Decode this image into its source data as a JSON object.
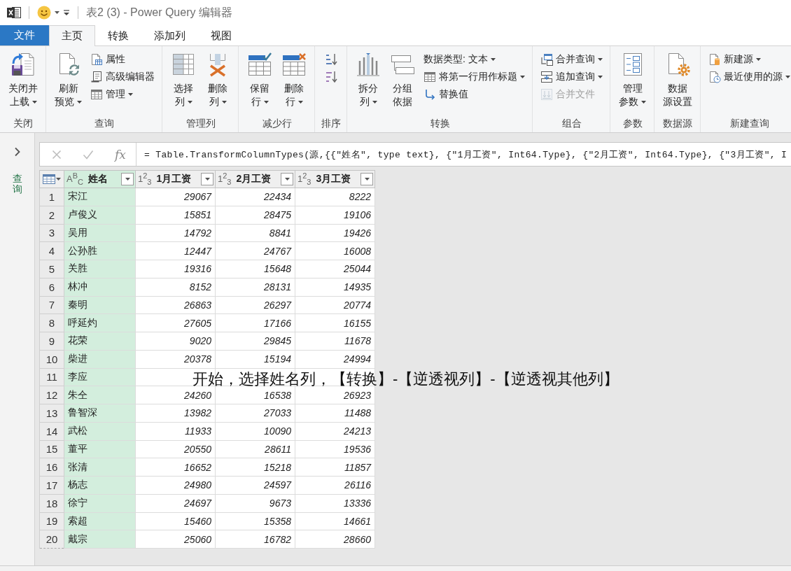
{
  "title_bar": {
    "title": "表2 (3) - Power Query 编辑器"
  },
  "tabs": [
    {
      "label": "文件",
      "kind": "file",
      "selected": false
    },
    {
      "label": "主页",
      "kind": "tab",
      "selected": true
    },
    {
      "label": "转换",
      "kind": "tab",
      "selected": false
    },
    {
      "label": "添加列",
      "kind": "tab",
      "selected": false
    },
    {
      "label": "视图",
      "kind": "tab",
      "selected": false
    }
  ],
  "ribbon": {
    "groups": [
      {
        "label": "关闭",
        "items": [
          {
            "kind": "large",
            "lines": [
              "关闭并",
              "上载"
            ],
            "dropdown": true,
            "disabled": false
          }
        ]
      },
      {
        "label": "查询",
        "items": [
          {
            "kind": "large",
            "lines": [
              "刷新",
              "预览"
            ],
            "dropdown": true,
            "disabled": false
          },
          {
            "kind": "small",
            "label": "属性",
            "dropdown": false,
            "disabled": false
          },
          {
            "kind": "small",
            "label": "高级编辑器",
            "dropdown": false,
            "disabled": false
          },
          {
            "kind": "small",
            "label": "管理",
            "dropdown": true,
            "disabled": false
          }
        ]
      },
      {
        "label": "管理列",
        "items": [
          {
            "kind": "large",
            "lines": [
              "选择",
              "列"
            ],
            "dropdown": true,
            "disabled": false
          },
          {
            "kind": "large",
            "lines": [
              "删除",
              "列"
            ],
            "dropdown": true,
            "disabled": false
          }
        ]
      },
      {
        "label": "减少行",
        "items": [
          {
            "kind": "large",
            "lines": [
              "保留",
              "行"
            ],
            "dropdown": true,
            "disabled": false
          },
          {
            "kind": "large",
            "lines": [
              "删除",
              "行"
            ],
            "dropdown": true,
            "disabled": false
          }
        ]
      },
      {
        "label": "排序",
        "items": [
          {
            "kind": "icon",
            "disabled": false
          },
          {
            "kind": "icon",
            "disabled": false
          }
        ]
      },
      {
        "label": "转换",
        "items": [
          {
            "kind": "large",
            "lines": [
              "拆分",
              "列"
            ],
            "dropdown": true,
            "disabled": false
          },
          {
            "kind": "large",
            "lines": [
              "分组",
              "依据"
            ],
            "dropdown": false,
            "disabled": false
          },
          {
            "kind": "small",
            "label": "数据类型: 文本",
            "dropdown": true,
            "disabled": false
          },
          {
            "kind": "small",
            "label": "将第一行用作标题",
            "dropdown": true,
            "disabled": false
          },
          {
            "kind": "small",
            "label": "替换值",
            "dropdown": false,
            "disabled": false
          }
        ]
      },
      {
        "label": "组合",
        "items": [
          {
            "kind": "small",
            "label": "合并查询",
            "dropdown": true,
            "disabled": false
          },
          {
            "kind": "small",
            "label": "追加查询",
            "dropdown": true,
            "disabled": false
          },
          {
            "kind": "small",
            "label": "合并文件",
            "dropdown": false,
            "disabled": true
          }
        ]
      },
      {
        "label": "参数",
        "items": [
          {
            "kind": "large",
            "lines": [
              "管理",
              "参数"
            ],
            "dropdown": true,
            "disabled": false
          }
        ]
      },
      {
        "label": "数据源",
        "items": [
          {
            "kind": "large",
            "lines": [
              "数据",
              "源设置"
            ],
            "dropdown": false,
            "disabled": false
          }
        ]
      },
      {
        "label": "新建查询",
        "items": [
          {
            "kind": "small",
            "label": "新建源",
            "dropdown": true,
            "disabled": false
          },
          {
            "kind": "small",
            "label": "最近使用的源",
            "dropdown": true,
            "disabled": false
          }
        ]
      }
    ]
  },
  "queries_pane": {
    "label": "查询",
    "expanded": false
  },
  "formula_bar": {
    "function_label": "fx",
    "formula": "= Table.TransformColumnTypes(源,{{\"姓名\", type text}, {\"1月工资\", Int64.Type}, {\"2月工资\", Int64.Type}, {\"3月工资\", I"
  },
  "table": {
    "columns": [
      {
        "label": "姓名",
        "kind": "text",
        "type_label": "A$^{B}$$_{C}$",
        "selected": true
      },
      {
        "label": "1月工资",
        "kind": "number",
        "type_label": "1$^{2}$$_{3}$",
        "selected": false
      },
      {
        "label": "2月工资",
        "kind": "number",
        "type_label": "1$^{2}$$_{3}$",
        "selected": false
      },
      {
        "label": "3月工资",
        "kind": "number",
        "type_label": "1$^{2}$$_{3}$",
        "selected": false
      }
    ],
    "rows": [
      {
        "number": "1",
        "cells": [
          "宋江",
          "29067",
          "22434",
          "8222"
        ]
      },
      {
        "number": "2",
        "cells": [
          "卢俊义",
          "15851",
          "28475",
          "19106"
        ]
      },
      {
        "number": "3",
        "cells": [
          "吴用",
          "14792",
          "8841",
          "19426"
        ]
      },
      {
        "number": "4",
        "cells": [
          "公孙胜",
          "12447",
          "24767",
          "16008"
        ]
      },
      {
        "number": "5",
        "cells": [
          "关胜",
          "19316",
          "15648",
          "25044"
        ]
      },
      {
        "number": "6",
        "cells": [
          "林冲",
          "8152",
          "28131",
          "14935"
        ]
      },
      {
        "number": "7",
        "cells": [
          "秦明",
          "26863",
          "26297",
          "20774"
        ]
      },
      {
        "number": "8",
        "cells": [
          "呼延灼",
          "27605",
          "17166",
          "16155"
        ]
      },
      {
        "number": "9",
        "cells": [
          "花荣",
          "9020",
          "29845",
          "11678"
        ]
      },
      {
        "number": "10",
        "cells": [
          "柴进",
          "20378",
          "15194",
          "24994"
        ]
      },
      {
        "number": "11",
        "cells": [
          "李应"
        ]
      },
      {
        "number": "12",
        "cells": [
          "朱仝",
          "24260",
          "16538",
          "26923"
        ]
      },
      {
        "number": "13",
        "cells": [
          "鲁智深",
          "13982",
          "27033",
          "11488"
        ]
      },
      {
        "number": "14",
        "cells": [
          "武松",
          "11933",
          "10090",
          "24213"
        ]
      },
      {
        "number": "15",
        "cells": [
          "董平",
          "20550",
          "28611",
          "19536"
        ]
      },
      {
        "number": "16",
        "cells": [
          "张清",
          "16652",
          "15218",
          "11857"
        ]
      },
      {
        "number": "17",
        "cells": [
          "杨志",
          "24980",
          "24597",
          "26116"
        ]
      },
      {
        "number": "18",
        "cells": [
          "徐宁",
          "24697",
          "9673",
          "13336"
        ]
      },
      {
        "number": "19",
        "cells": [
          "索超",
          "15460",
          "15358",
          "14661"
        ]
      },
      {
        "number": "20",
        "cells": [
          "戴宗",
          "25060",
          "16782",
          "28660"
        ]
      }
    ]
  },
  "caption": "开始，选择姓名列，【转换】-【逆透视列】-【逆透视其他列】"
}
